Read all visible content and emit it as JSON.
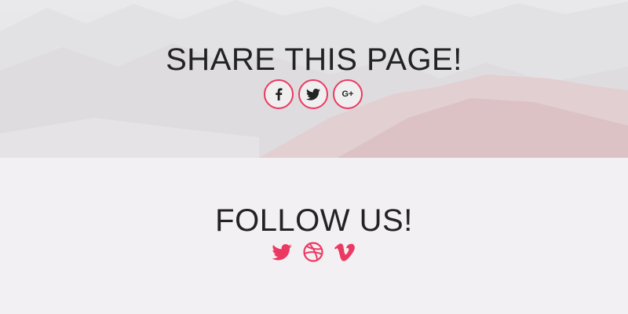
{
  "share": {
    "title": "SHARE THIS PAGE!",
    "buttons": [
      {
        "network": "facebook",
        "icon": "facebook-icon"
      },
      {
        "network": "twitter",
        "icon": "twitter-icon"
      },
      {
        "network": "google-plus",
        "icon": "google-plus-icon",
        "glyph": "G+"
      }
    ],
    "accent_color": "#ec3962"
  },
  "follow": {
    "title": "FOLLOW US!",
    "icons": [
      {
        "network": "twitter",
        "icon": "twitter-icon"
      },
      {
        "network": "dribbble",
        "icon": "dribbble-icon"
      },
      {
        "network": "vimeo",
        "icon": "vimeo-icon"
      }
    ],
    "icon_color": "#ec3962"
  }
}
